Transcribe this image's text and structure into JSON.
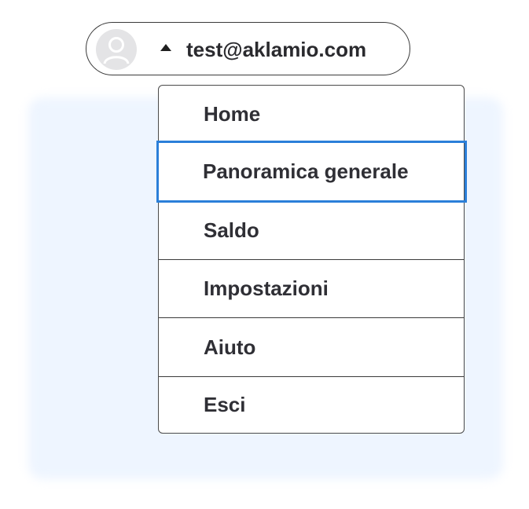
{
  "account": {
    "email": "test@aklamio.com",
    "avatar_icon": "user-avatar-icon",
    "caret_icon": "caret-up-icon"
  },
  "menu": {
    "items": [
      {
        "label": "Home",
        "state": "default"
      },
      {
        "label": "Panoramica generale",
        "state": "focused"
      },
      {
        "label": "Saldo",
        "state": "default"
      },
      {
        "label": "Impostazioni",
        "state": "default"
      },
      {
        "label": "Aiuto",
        "state": "default"
      },
      {
        "label": "Esci",
        "state": "default"
      }
    ]
  },
  "colors": {
    "focus_ring": "#2b7fd9",
    "backdrop": "#eef5ff",
    "text": "#2f2f35"
  }
}
